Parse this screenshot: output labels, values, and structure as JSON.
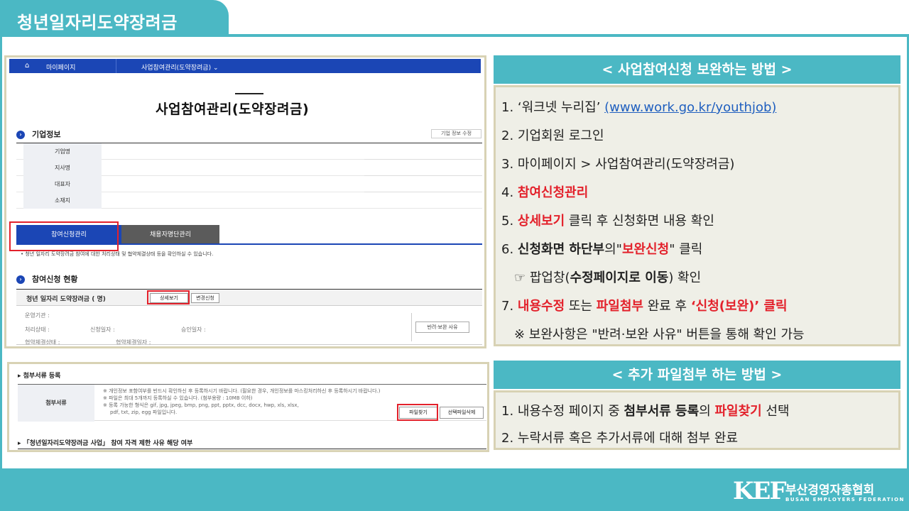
{
  "header": {
    "title": "청년일자리도약장려금"
  },
  "footer": {
    "logo": "KEF",
    "org_name": "부산경영자총협회",
    "org_subtitle": "BUSAN EMPLOYERS FEDERATION"
  },
  "screenshot1": {
    "nav": {
      "home_icon": "⌂",
      "mypage": "마이페이지",
      "current": "사업참여관리(도약장려금) ⌄"
    },
    "page_title": "사업참여관리(도약장려금)",
    "company_section": {
      "title": "기업정보",
      "edit_button": "기업 정보 수정",
      "rows": [
        "기업명",
        "지사명",
        "대표자",
        "소재지"
      ]
    },
    "tabs": {
      "active": "참여신청관리",
      "inactive": "채용자명단관리"
    },
    "tab_note": "• 청년 일자리 도약장려금 참여에 대한 처리상태 및 협약체결상태 등을 확인하실 수 있습니다.",
    "participation": {
      "title": "참여신청 현황",
      "bar_title": "청년 일자리 도약장려금 (     명)",
      "detail_button": "상세보기",
      "change_button": "변경신청",
      "fields": {
        "agency": "운영기관 :",
        "status": "처리상태 :",
        "apply_date": "신청일자 :",
        "approve_date": "승인일자 :",
        "contract_status": "협약체결상태 :",
        "contract_date": "협약체결일자 :"
      },
      "reason_button": "반려·보완 사유"
    }
  },
  "screenshot2": {
    "title": "▸ 첨부서류 등록",
    "label": "첨부서류",
    "notes": [
      "※ 개인정보 포함여부를 반드시 확인하신 후 등록하시기 바랍니다. (필요한 경우, 개인정보를 마스킹처리하신 후 등록하시기 바랍니다.)",
      "※ 파일은 최대 5개까지 등록하실 수 있습니다. (첨부용량 : 10MB 이하)",
      "※ 등록 가능한 형식은 gif, jpg, jpeg, bmp, png, ppt, pptx, dcc, docx, hwp, xls, xlsx,",
      "pdf, txt, zip, egg 파일입니다."
    ],
    "find_button": "파일찾기",
    "delete_button": "선택파일삭제",
    "bottom_title": "▸ 「청년일자리도약장려금 사업」 참여 자격 제한 사유 해당 여부"
  },
  "panel1": {
    "title": "< 사업참여신청 보완하는 방법 >",
    "step1_a": "1. ‘워크넷 누리집’ ",
    "step1_link": "(www.work.go.kr/youthjob)",
    "step2": "2. 기업회원 로그인",
    "step3": "3. 마이페이지 > 사업참여관리(도약장려금)",
    "step4_num": "4. ",
    "step4_red": "참여신청관리",
    "step5_num": "5. ",
    "step5_red": "상세보기",
    "step5_rest": " 클릭 후 신청화면 내용 확인",
    "step6_num": "6. ",
    "step6_bold": "신청화면 하단부",
    "step6_mid": "의\"",
    "step6_red": "보완신청",
    "step6_rest": "\" 클릭",
    "step6b_a": "☞ 팝업창(",
    "step6b_bold": "수정페이지로 이동",
    "step6b_rest": ") 확인",
    "step7_num": "7. ",
    "step7_red1": "내용수정",
    "step7_mid1": " 또는 ",
    "step7_red2": "파일첨부",
    "step7_mid2": "  완료 후 ",
    "step7_red3": "‘신청(보완)’ 클릭",
    "step8": "※ 보완사항은 \"반려·보완 사유\" 버튼을 통해 확인 가능"
  },
  "panel2": {
    "title": "< 추가 파일첨부 하는 방법 >",
    "step1_a": "1. 내용수정 페이지 중  ",
    "step1_bold": "첨부서류 등록",
    "step1_mid": "의 ",
    "step1_red": "파일찾기",
    "step1_rest": " 선택",
    "step2": "2. 누락서류 혹은 추가서류에 대해 첨부 완료"
  },
  "colors": {
    "teal": "#4bb8c4",
    "navy": "#1b46b5",
    "red": "#e3212b",
    "panel_bg": "#efefe7"
  }
}
